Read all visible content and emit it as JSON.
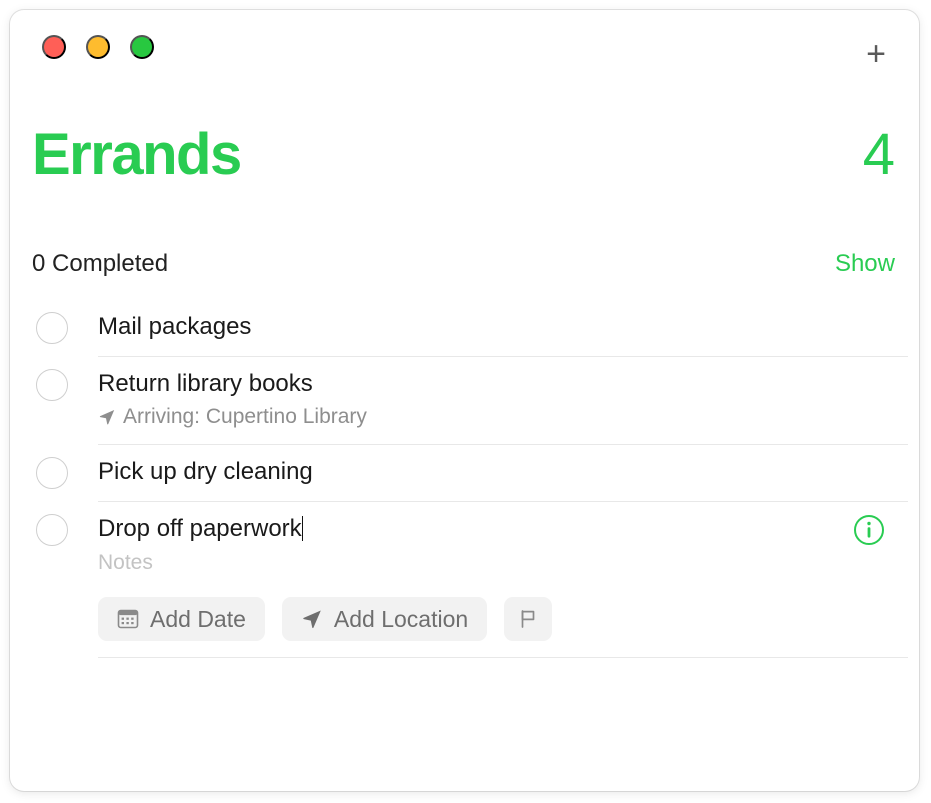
{
  "window": {
    "traffic_lights": [
      {
        "name": "close",
        "color": "#ff5f57"
      },
      {
        "name": "minimize",
        "color": "#febc2e"
      },
      {
        "name": "maximize",
        "color": "#28c840"
      }
    ],
    "add_button_glyph": "+"
  },
  "header": {
    "title": "Errands",
    "count": "4",
    "accent_color": "#29cc52"
  },
  "completed": {
    "label": "0 Completed",
    "show_label": "Show"
  },
  "reminders": [
    {
      "title": "Mail packages",
      "subtitle": "",
      "notes_placeholder": "",
      "selected": false,
      "completed": false
    },
    {
      "title": "Return library books",
      "subtitle": "Arriving: Cupertino Library",
      "subtitle_icon": "location-arrow-icon",
      "notes_placeholder": "",
      "selected": false,
      "completed": false
    },
    {
      "title": "Pick up dry cleaning",
      "subtitle": "",
      "notes_placeholder": "",
      "selected": false,
      "completed": false
    },
    {
      "title": "Drop off paperwork",
      "subtitle": "",
      "notes_placeholder": "Notes",
      "selected": true,
      "completed": false
    }
  ],
  "detail_actions": {
    "add_date_label": "Add Date",
    "add_location_label": "Add Location",
    "flag_label": ""
  }
}
